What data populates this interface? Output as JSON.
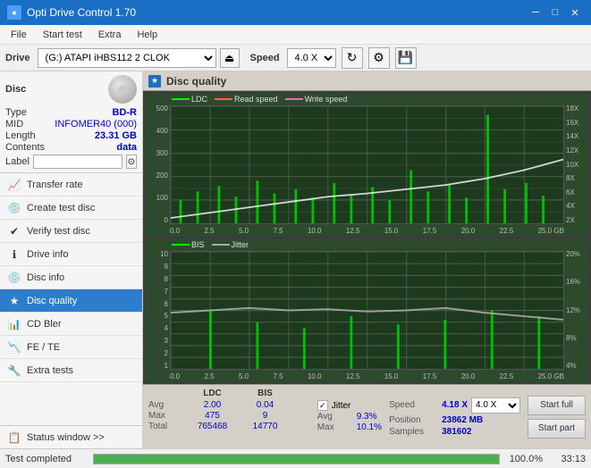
{
  "titlebar": {
    "title": "Opti Drive Control 1.70",
    "icon": "●",
    "minimize": "─",
    "maximize": "□",
    "close": "✕"
  },
  "menubar": {
    "items": [
      "File",
      "Start test",
      "Extra",
      "Help"
    ]
  },
  "drivebar": {
    "label": "Drive",
    "drive_value": "(G:) ATAPI iHBS112  2 CLOK",
    "speed_label": "Speed",
    "speed_value": "4.0 X"
  },
  "disc": {
    "type_label": "Type",
    "type_value": "BD-R",
    "mid_label": "MID",
    "mid_value": "INFOMER40 (000)",
    "length_label": "Length",
    "length_value": "23.31 GB",
    "contents_label": "Contents",
    "contents_value": "data",
    "label_label": "Label"
  },
  "nav": {
    "items": [
      {
        "id": "transfer-rate",
        "label": "Transfer rate",
        "icon": "📈"
      },
      {
        "id": "create-test-disc",
        "label": "Create test disc",
        "icon": "💿"
      },
      {
        "id": "verify-test-disc",
        "label": "Verify test disc",
        "icon": "✔"
      },
      {
        "id": "drive-info",
        "label": "Drive info",
        "icon": "ℹ"
      },
      {
        "id": "disc-info",
        "label": "Disc info",
        "icon": "💿"
      },
      {
        "id": "disc-quality",
        "label": "Disc quality",
        "icon": "★",
        "active": true
      },
      {
        "id": "cd-bler",
        "label": "CD Bler",
        "icon": "📊"
      },
      {
        "id": "fe-te",
        "label": "FE / TE",
        "icon": "📉"
      },
      {
        "id": "extra-tests",
        "label": "Extra tests",
        "icon": "🔧"
      }
    ],
    "status_window": "Status window >>"
  },
  "panel": {
    "title": "Disc quality",
    "icon": "★"
  },
  "chart1": {
    "title": "Disc quality",
    "legend": {
      "ldc": "LDC",
      "read": "Read speed",
      "write": "Write speed"
    },
    "y_left": [
      "500",
      "400",
      "300",
      "200",
      "100",
      "0"
    ],
    "y_right": [
      "18X",
      "16X",
      "14X",
      "12X",
      "10X",
      "8X",
      "6X",
      "4X",
      "2X"
    ],
    "x_labels": [
      "0.0",
      "2.5",
      "5.0",
      "7.5",
      "10.0",
      "12.5",
      "15.0",
      "17.5",
      "20.0",
      "22.5",
      "25.0 GB"
    ]
  },
  "chart2": {
    "legend": {
      "bis": "BIS",
      "jitter": "Jitter"
    },
    "y_left": [
      "10",
      "9",
      "8",
      "7",
      "6",
      "5",
      "4",
      "3",
      "2",
      "1"
    ],
    "y_right": [
      "20%",
      "16%",
      "12%",
      "8%",
      "4%"
    ],
    "x_labels": [
      "0.0",
      "2.5",
      "5.0",
      "7.5",
      "10.0",
      "12.5",
      "15.0",
      "17.5",
      "20.0",
      "22.5",
      "25.0 GB"
    ]
  },
  "stats": {
    "header": [
      "",
      "LDC",
      "BIS"
    ],
    "avg_label": "Avg",
    "avg_ldc": "2.00",
    "avg_bis": "0.04",
    "max_label": "Max",
    "max_ldc": "475",
    "max_bis": "9",
    "total_label": "Total",
    "total_ldc": "765468",
    "total_bis": "14770",
    "jitter_label": "Jitter",
    "jitter_checked": true,
    "jitter_avg": "9.3%",
    "jitter_max": "10.1%",
    "speed_label": "Speed",
    "speed_value": "4.18 X",
    "speed_select": "4.0 X",
    "position_label": "Position",
    "position_value": "23862 MB",
    "samples_label": "Samples",
    "samples_value": "381602",
    "start_full": "Start full",
    "start_part": "Start part"
  },
  "bottombar": {
    "status": "Test completed",
    "progress": 100,
    "progress_label": "100.0%",
    "time": "33:13"
  }
}
